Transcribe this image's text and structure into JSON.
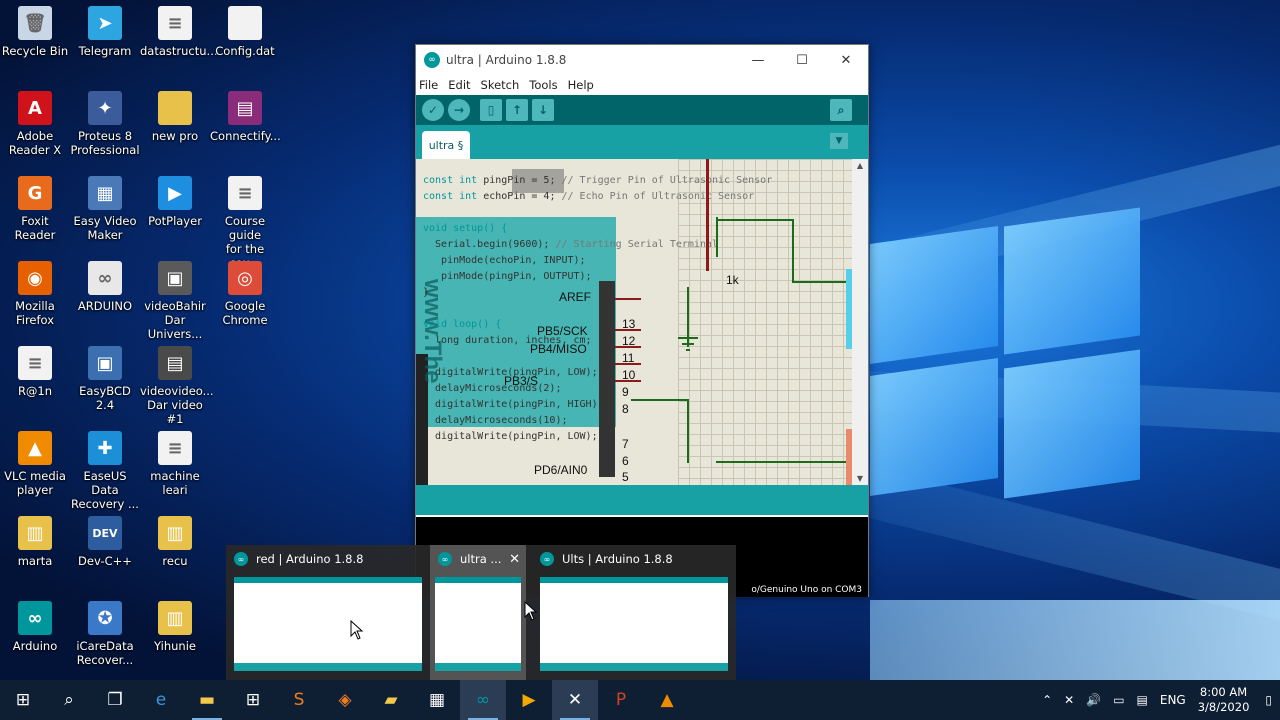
{
  "desktop": {
    "icons": [
      {
        "label": "Recycle Bin",
        "icon": "recycle-bin-icon",
        "color": "#c8d6e6",
        "glyph": "🗑"
      },
      {
        "label": "Telegram",
        "icon": "telegram-icon",
        "color": "#2ca5e0",
        "glyph": "➤"
      },
      {
        "label": "datastructu...",
        "icon": "document-icon",
        "color": "#f2f2f2",
        "glyph": "≡"
      },
      {
        "label": "Config.dat",
        "icon": "file-icon",
        "color": "#f2f2f2",
        "glyph": ""
      },
      {
        "label": "Adobe\nReader X",
        "icon": "adobe-reader-icon",
        "color": "#d0121b",
        "glyph": "A"
      },
      {
        "label": "Proteus 8\nProfessional",
        "icon": "proteus-icon",
        "color": "#3b5b9a",
        "glyph": "✦"
      },
      {
        "label": "new pro",
        "icon": "folder-icon",
        "color": "#e8c14b",
        "glyph": ""
      },
      {
        "label": "Connectify...",
        "icon": "winrar-icon",
        "color": "#8a2c7a",
        "glyph": "▤"
      },
      {
        "label": "Foxit Reader",
        "icon": "foxit-reader-icon",
        "color": "#e86a1c",
        "glyph": "G"
      },
      {
        "label": "Easy Video\nMaker",
        "icon": "easy-video-maker-icon",
        "color": "#4a79b8",
        "glyph": "▦"
      },
      {
        "label": "PotPlayer",
        "icon": "potplayer-icon",
        "color": "#1e8fe0",
        "glyph": "▶"
      },
      {
        "label": "Course guide\nfor the cou...",
        "icon": "document-icon",
        "color": "#f2f2f2",
        "glyph": "≡"
      },
      {
        "label": "Mozilla\nFirefox",
        "icon": "firefox-icon",
        "color": "#e66000",
        "glyph": "◉"
      },
      {
        "label": "ARDUINO",
        "icon": "arduino-folder-icon",
        "color": "#e8e8e8",
        "glyph": "∞"
      },
      {
        "label": "videoBahir\nDar Univers...",
        "icon": "video-file-icon",
        "color": "#5a5a5a",
        "glyph": "▣"
      },
      {
        "label": "Google\nChrome",
        "icon": "chrome-icon",
        "color": "#dd4b39",
        "glyph": "◎"
      },
      {
        "label": "R@1n",
        "icon": "text-file-icon",
        "color": "#f2f2f2",
        "glyph": "≡"
      },
      {
        "label": "EasyBCD 2.4",
        "icon": "easybcd-icon",
        "color": "#3b6fb0",
        "glyph": "▣"
      },
      {
        "label": "videovideo...\nDar video #1",
        "icon": "video-file-icon",
        "color": "#4a4a4a",
        "glyph": "▤"
      },
      {
        "label": "",
        "icon": "blank-icon",
        "color": "transparent",
        "glyph": ""
      },
      {
        "label": "VLC media\nplayer",
        "icon": "vlc-icon",
        "color": "#f08a00",
        "glyph": "▲"
      },
      {
        "label": "EaseUS Data\nRecovery ...",
        "icon": "easeus-icon",
        "color": "#1d8fd6",
        "glyph": "✚"
      },
      {
        "label": "machine leari",
        "icon": "document-icon",
        "color": "#f2f2f2",
        "glyph": "≡"
      },
      {
        "label": "",
        "icon": "blank-icon",
        "color": "transparent",
        "glyph": ""
      },
      {
        "label": "marta",
        "icon": "zip-folder-icon",
        "color": "#e8c14b",
        "glyph": "▥"
      },
      {
        "label": "Dev-C++",
        "icon": "devcpp-icon",
        "color": "#2d5d9f",
        "glyph": "DEV"
      },
      {
        "label": "recu",
        "icon": "zip-folder-icon",
        "color": "#e8c14b",
        "glyph": "▥"
      },
      {
        "label": "",
        "icon": "blank-icon",
        "color": "transparent",
        "glyph": ""
      },
      {
        "label": "Arduino",
        "icon": "arduino-icon",
        "color": "#00979c",
        "glyph": "∞"
      },
      {
        "label": "iCareData\nRecover...",
        "icon": "icare-icon",
        "color": "#3a78c8",
        "glyph": "✪"
      },
      {
        "label": "Yihunie",
        "icon": "zip-folder-icon",
        "color": "#e8c14b",
        "glyph": "▥"
      }
    ]
  },
  "arduino_window": {
    "title": "ultra | Arduino 1.8.8",
    "controls": {
      "minimize": "—",
      "maximize": "☐",
      "close": "✕"
    },
    "menu": [
      "File",
      "Edit",
      "Sketch",
      "Tools",
      "Help"
    ],
    "tab": "ultra §",
    "code": {
      "l1a": "const int ",
      "l1b": "pingPin = 5; ",
      "l1c": "// Trigger Pin of Ultrasonic Sensor",
      "l2a": "const int ",
      "l2b": "echoPin = 4; ",
      "l2c": "// Echo Pin of Ultrasonic Sensor",
      "l3": "void setup() {",
      "l4a": "  Serial.begin(9600); ",
      "l4b": "// Starting Serial Terminal",
      "l5": "   pinMode(echoPin, INPUT);",
      "l6": "   pinMode(pingPin, OUTPUT);",
      "l7": "}",
      "l8": "void loop() {",
      "l9": "  long duration, inches, cm;",
      "l10": "  digitalWrite(pingPin, LOW);",
      "l11": "  delayMicroseconds(2);",
      "l12": "  digitalWrite(pingPin, HIGH);",
      "l13": "  delayMicroseconds(10);",
      "l14": "  digitalWrite(pingPin, LOW);"
    },
    "schematic": {
      "pins": [
        "AREF",
        "PB5/SCK",
        "PB4/MISO",
        "PB3/S",
        "PD6/AIN0"
      ],
      "pin_numbers": [
        "13",
        "12",
        "11",
        "10",
        "9",
        "8",
        "7",
        "6",
        "5"
      ],
      "resistor_label": "1k",
      "watermark": "www.The"
    },
    "status": "o/Genuino Uno on COM3"
  },
  "task_thumbnails": [
    {
      "title": "red | Arduino 1.8.8"
    },
    {
      "title": "ultra ...",
      "close": "✕"
    },
    {
      "title": "Ults | Arduino 1.8.8"
    }
  ],
  "taskbar": {
    "apps": [
      "start-icon",
      "search-icon",
      "task-view-icon",
      "edge-icon",
      "file-explorer-icon",
      "store-icon",
      "sublime-icon",
      "app-icon",
      "folder-icon",
      "calculator-icon",
      "arduino-icon",
      "video-icon",
      "proteus-icon",
      "powerpoint-icon",
      "vlc-icon"
    ],
    "language": "ENG",
    "time": "8:00 AM",
    "date": "3/8/2020"
  }
}
